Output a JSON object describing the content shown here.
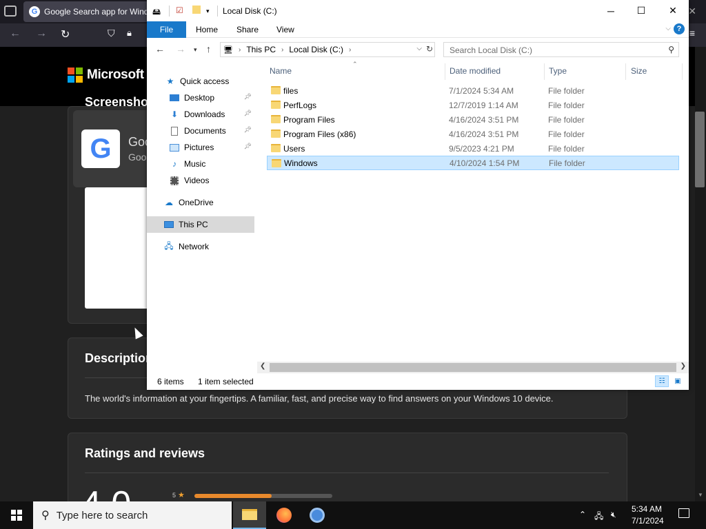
{
  "browser": {
    "tab_title": "Google Search app for Windo",
    "tab_favicon": "G"
  },
  "store": {
    "brand": "Microsoft",
    "screenshots_title": "Screenshots",
    "app_name": "Goo",
    "app_sub": "Goo",
    "description_title": "Description",
    "description_text": "The world's information at your fingertips. A familiar, fast, and precise way to find answers on your Windows 10 device.",
    "ratings_title": "Ratings and reviews",
    "rating_value": "4.0",
    "rating_row_label": "5",
    "rating_row_fill": 0.56
  },
  "explorer": {
    "title": "Local Disk (C:)",
    "ribbon": {
      "file": "File",
      "home": "Home",
      "share": "Share",
      "view": "View",
      "help": "?"
    },
    "breadcrumb": [
      "This PC",
      "Local Disk (C:)"
    ],
    "search_placeholder": "Search Local Disk (C:)",
    "nav": {
      "quick_access": "Quick access",
      "desktop": "Desktop",
      "downloads": "Downloads",
      "documents": "Documents",
      "pictures": "Pictures",
      "music": "Music",
      "videos": "Videos",
      "onedrive": "OneDrive",
      "this_pc": "This PC",
      "network": "Network"
    },
    "columns": {
      "name": "Name",
      "date": "Date modified",
      "type": "Type",
      "size": "Size"
    },
    "files": [
      {
        "name": "files",
        "date": "7/1/2024 5:34 AM",
        "type": "File folder"
      },
      {
        "name": "PerfLogs",
        "date": "12/7/2019 1:14 AM",
        "type": "File folder"
      },
      {
        "name": "Program Files",
        "date": "4/16/2024 3:51 PM",
        "type": "File folder"
      },
      {
        "name": "Program Files (x86)",
        "date": "4/16/2024 3:51 PM",
        "type": "File folder"
      },
      {
        "name": "Users",
        "date": "9/5/2023 4:21 PM",
        "type": "File folder"
      },
      {
        "name": "Windows",
        "date": "4/10/2024 1:54 PM",
        "type": "File folder"
      }
    ],
    "status": {
      "count": "6 items",
      "selected": "1 item selected"
    }
  },
  "taskbar": {
    "search_placeholder": "Type here to search",
    "time": "5:34 AM",
    "date": "7/1/2024"
  },
  "colors": {
    "accent": "#1979ca",
    "selection": "#cce8ff",
    "folder": "#f8d775"
  }
}
